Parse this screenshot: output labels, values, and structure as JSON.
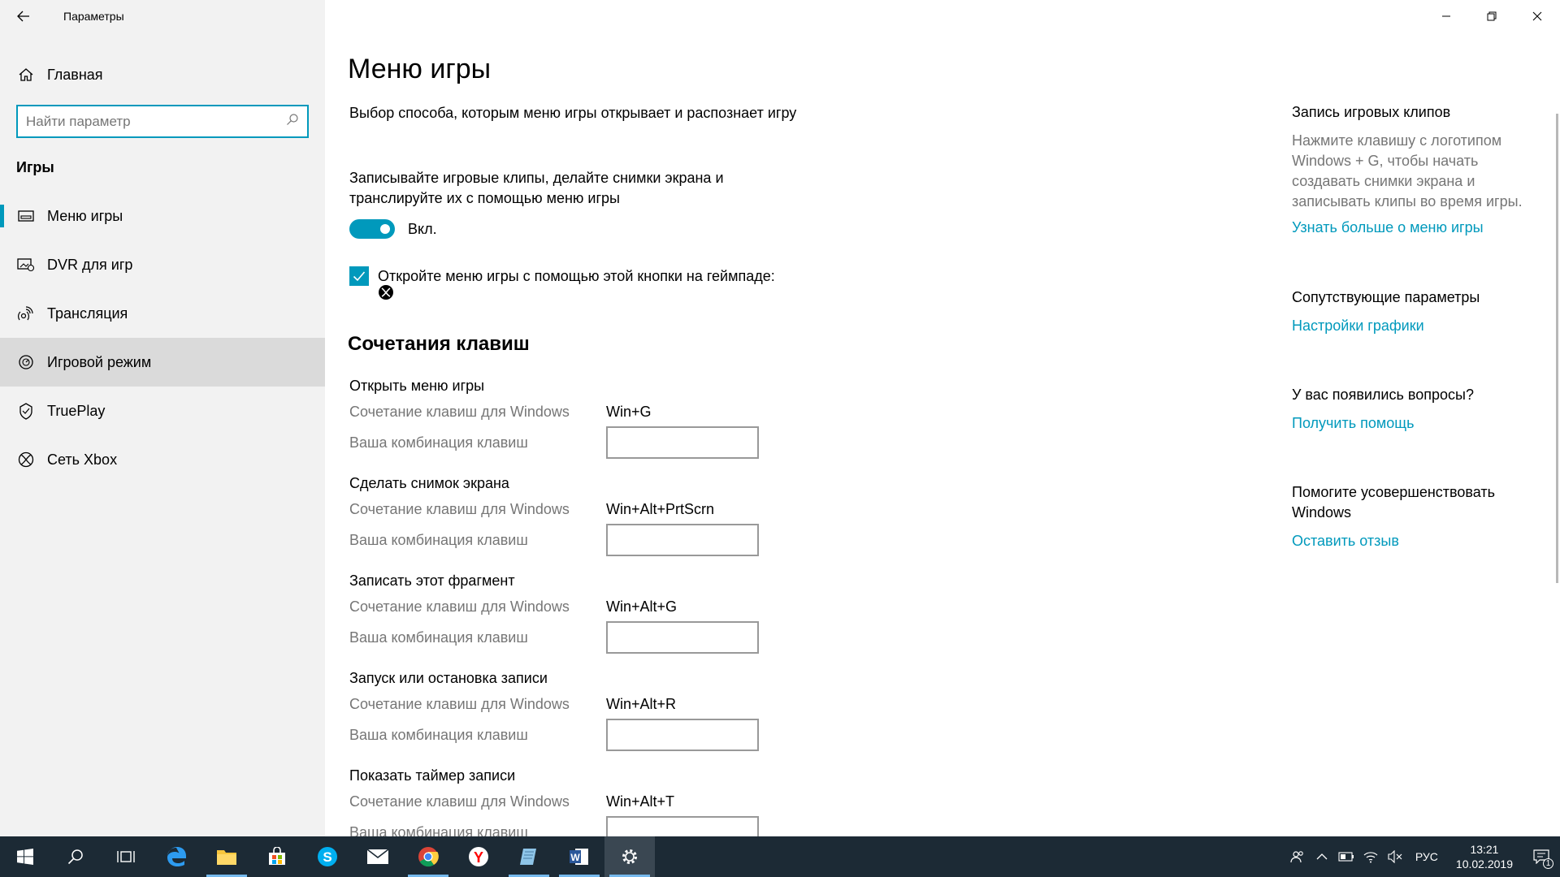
{
  "window": {
    "title": "Параметры"
  },
  "sidebar": {
    "home": "Главная",
    "search_placeholder": "Найти параметр",
    "section": "Игры",
    "items": [
      {
        "label": "Меню игры",
        "icon": "game-bar-icon"
      },
      {
        "label": "DVR для игр",
        "icon": "dvr-icon"
      },
      {
        "label": "Трансляция",
        "icon": "broadcast-icon"
      },
      {
        "label": "Игровой режим",
        "icon": "game-mode-icon"
      },
      {
        "label": "TruePlay",
        "icon": "trueplay-icon"
      },
      {
        "label": "Сеть Xbox",
        "icon": "xbox-icon"
      }
    ]
  },
  "main": {
    "title": "Меню игры",
    "description": "Выбор способа, которым меню игры открывает и распознает игру",
    "record_text": "Записывайте игровые клипы, делайте снимки экрана и транслируйте их с помощью меню игры",
    "toggle_state": "Вкл.",
    "checkbox_text": "Откройте меню игры с помощью этой кнопки на геймпаде:",
    "shortcuts_heading": "Сочетания клавиш",
    "windows_label": "Сочетание клавиш для Windows",
    "custom_label": "Ваша комбинация клавиш",
    "shortcuts": [
      {
        "title": "Открыть меню игры",
        "keys": "Win+G"
      },
      {
        "title": "Сделать снимок экрана",
        "keys": "Win+Alt+PrtScrn"
      },
      {
        "title": "Записать этот фрагмент",
        "keys": "Win+Alt+G"
      },
      {
        "title": "Запуск или остановка записи",
        "keys": "Win+Alt+R"
      },
      {
        "title": "Показать таймер записи",
        "keys": "Win+Alt+T"
      }
    ]
  },
  "right_pane": {
    "clips_heading": "Запись игровых клипов",
    "clips_text": "Нажмите клавишу с логотипом Windows + G, чтобы начать создавать снимки экрана и записывать клипы во время игры.",
    "clips_link": "Узнать больше о меню игры",
    "related_heading": "Сопутствующие параметры",
    "related_link": "Настройки графики",
    "questions_heading": "У вас появились вопросы?",
    "questions_link": "Получить помощь",
    "improve_heading": "Помогите усовершенствовать Windows",
    "improve_link": "Оставить отзыв"
  },
  "taskbar": {
    "lang": "РУС",
    "time": "13:21",
    "date": "10.02.2019",
    "notification_count": "1"
  },
  "colors": {
    "accent": "#0099bc",
    "taskbar": "#1c2a35",
    "sidebar": "#f2f2f2"
  }
}
